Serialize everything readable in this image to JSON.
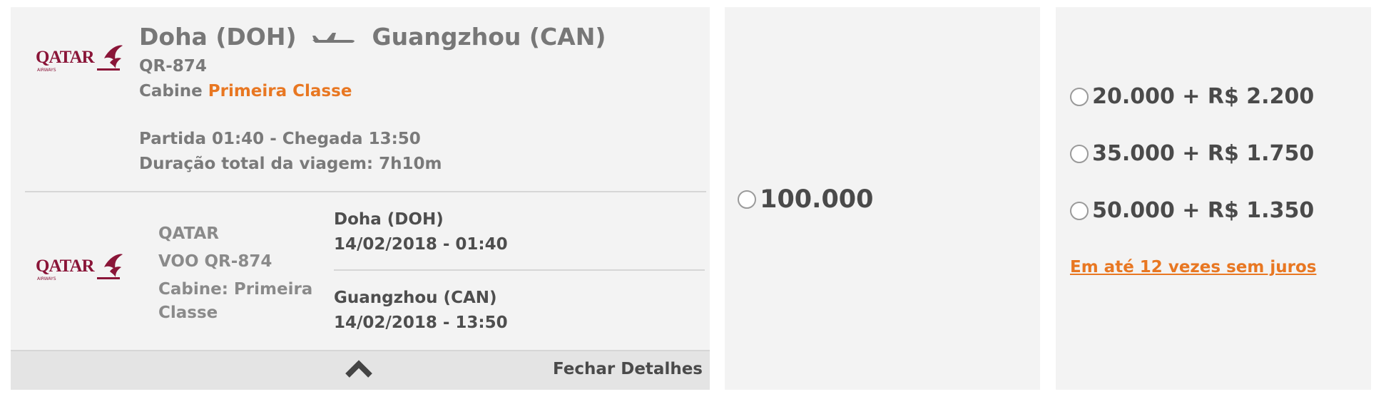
{
  "flight": {
    "airline_logo_text": "QATAR",
    "airline_logo_subtext": "AIRWAYS",
    "origin": "Doha (DOH)",
    "destination": "Guangzhou (CAN)",
    "flight_number": "QR-874",
    "cabin_prefix": "Cabine",
    "cabin_class": "Primeira Classe",
    "schedule": "Partida 01:40 - Chegada 13:50",
    "duration": "Duração total da viagem: 7h10m"
  },
  "segment": {
    "airline": "QATAR",
    "flight": "VOO QR-874",
    "cabin_line1": "Cabine: Primeira",
    "cabin_line2": "Classe",
    "departure_city": "Doha (DOH)",
    "departure_datetime": "14/02/2018 - 01:40",
    "arrival_city": "Guangzhou (CAN)",
    "arrival_datetime": "14/02/2018 - 13:50"
  },
  "footer": {
    "close_label": "Fechar Detalhes"
  },
  "points_only": {
    "option": "100.000"
  },
  "points_plus_cash": {
    "options": [
      "20.000 + R$ 2.200",
      "35.000 + R$ 1.750",
      "50.000 + R$ 1.350"
    ],
    "installments_link": "Em até 12 vezes sem juros"
  },
  "colors": {
    "accent": "#e87722",
    "brand": "#8a1538",
    "panel_bg": "#f3f3f3"
  }
}
